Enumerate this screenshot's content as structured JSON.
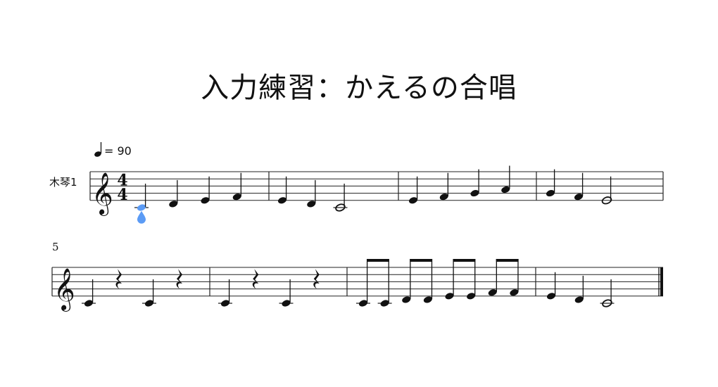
{
  "score": {
    "title": "入力練習：かえるの合唱",
    "instrument_label": "木琴1",
    "tempo_marking": {
      "value": "= 90"
    },
    "time_signature": {
      "top": "4",
      "bottom": "4"
    },
    "clef": "treble",
    "measure_number_system2": "5",
    "selection_color": "#5b9bf5",
    "systems": [
      {
        "measures": [
          [
            {
              "pitch": "C4",
              "dur": "q",
              "selected": true
            },
            {
              "pitch": "D4",
              "dur": "q"
            },
            {
              "pitch": "E4",
              "dur": "q"
            },
            {
              "pitch": "F4",
              "dur": "q"
            }
          ],
          [
            {
              "pitch": "E4",
              "dur": "q"
            },
            {
              "pitch": "D4",
              "dur": "q"
            },
            {
              "pitch": "C4",
              "dur": "h"
            }
          ],
          [
            {
              "pitch": "E4",
              "dur": "q"
            },
            {
              "pitch": "F4",
              "dur": "q"
            },
            {
              "pitch": "G4",
              "dur": "q"
            },
            {
              "pitch": "A4",
              "dur": "q"
            }
          ],
          [
            {
              "pitch": "G4",
              "dur": "q"
            },
            {
              "pitch": "F4",
              "dur": "q"
            },
            {
              "pitch": "E4",
              "dur": "h"
            }
          ]
        ]
      },
      {
        "measures": [
          [
            {
              "pitch": "C4",
              "dur": "q"
            },
            {
              "pitch": "rest",
              "dur": "q"
            },
            {
              "pitch": "C4",
              "dur": "q"
            },
            {
              "pitch": "rest",
              "dur": "q"
            }
          ],
          [
            {
              "pitch": "C4",
              "dur": "q"
            },
            {
              "pitch": "rest",
              "dur": "q"
            },
            {
              "pitch": "C4",
              "dur": "q"
            },
            {
              "pitch": "rest",
              "dur": "q"
            }
          ],
          [
            {
              "pitch": "C4",
              "dur": "8"
            },
            {
              "pitch": "C4",
              "dur": "8"
            },
            {
              "pitch": "D4",
              "dur": "8"
            },
            {
              "pitch": "D4",
              "dur": "8"
            },
            {
              "pitch": "E4",
              "dur": "8"
            },
            {
              "pitch": "E4",
              "dur": "8"
            },
            {
              "pitch": "F4",
              "dur": "8"
            },
            {
              "pitch": "F4",
              "dur": "8"
            }
          ],
          [
            {
              "pitch": "E4",
              "dur": "q"
            },
            {
              "pitch": "D4",
              "dur": "q"
            },
            {
              "pitch": "C4",
              "dur": "h"
            }
          ]
        ],
        "final_barline": true
      }
    ]
  }
}
